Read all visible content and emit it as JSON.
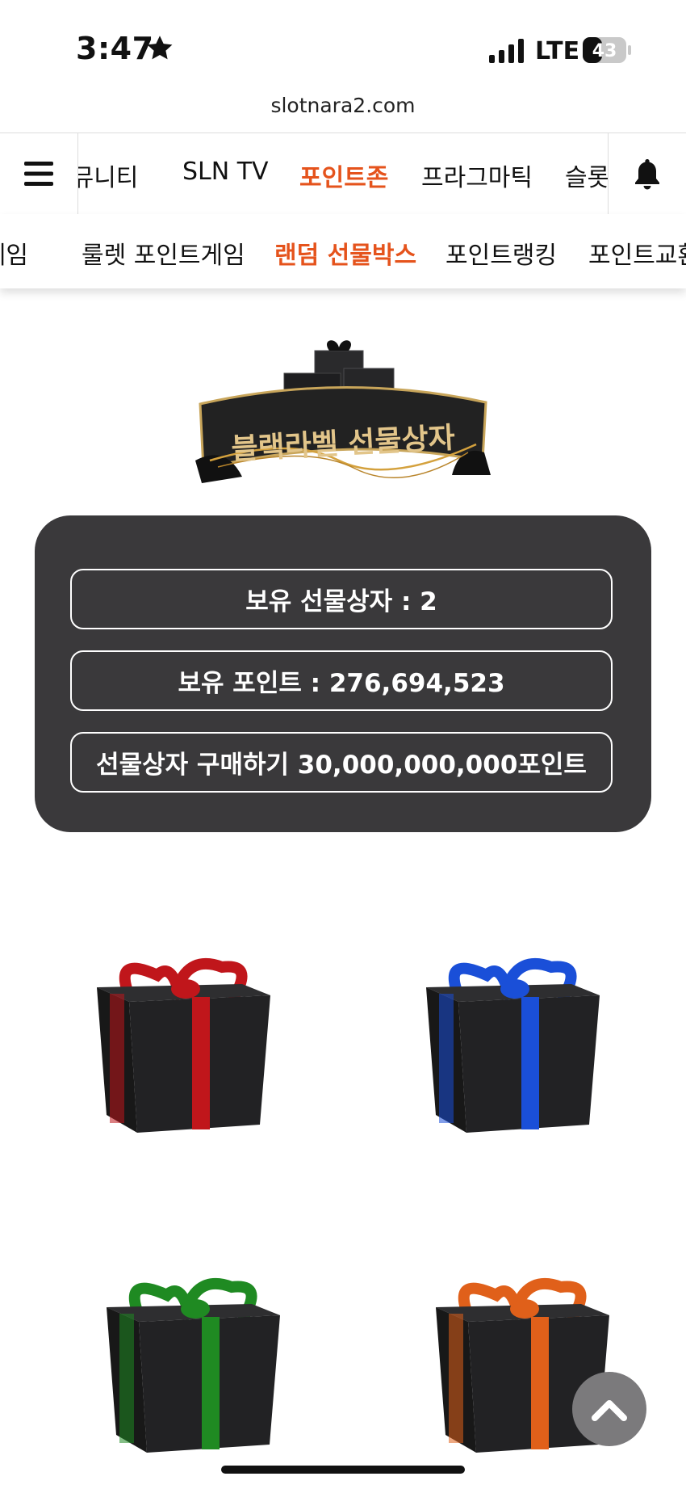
{
  "status_bar": {
    "time": "3:47",
    "network": "LTE",
    "battery": "43"
  },
  "browser": {
    "url": "slotnara2.com"
  },
  "top_nav": {
    "items": [
      "커뮤니티",
      "SLN TV",
      "포인트존",
      "프라그마틱",
      "슬롯"
    ],
    "active": "포인트존"
  },
  "sub_nav": {
    "items": [
      "포인트게임",
      "룰렛 포인트게임",
      "랜덤 선물박스",
      "포인트랭킹",
      "포인트교환"
    ],
    "active": "랜덤 선물박스"
  },
  "banner": {
    "title": "블랙라벨 선물상자"
  },
  "info": {
    "owned_boxes": "보유 선물상자 : 2",
    "owned_points": "보유 포인트 : 276,694,523",
    "buy": "선물상자 구매하기 30,000,000,000포인트"
  },
  "gifts": [
    {
      "ribbon": "red",
      "color": "#c0161b"
    },
    {
      "ribbon": "blue",
      "color": "#1a4fd8"
    },
    {
      "ribbon": "green",
      "color": "#1f8a22"
    },
    {
      "ribbon": "orange",
      "color": "#e0601a"
    }
  ],
  "colors": {
    "accent": "#e5531c",
    "panel": "#3a393b"
  }
}
